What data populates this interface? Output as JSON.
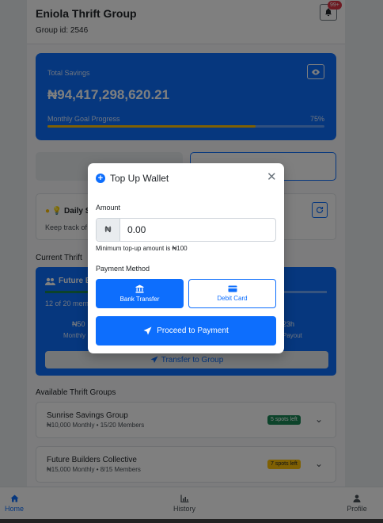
{
  "header": {
    "title": "Eniola Thrift Group",
    "group_id": "Group id: 2546",
    "notification_badge": "99+"
  },
  "savings": {
    "label": "Total Savings",
    "amount": "₦94,417,298,620.21",
    "goal_label": "Monthly Goal Progress",
    "goal_percent_text": "75%",
    "goal_progress": 0.75
  },
  "tip": {
    "title": "💡 Daily S",
    "text": "Keep track of"
  },
  "current_section": {
    "title": "Current Thrift",
    "name": "Future B",
    "members": "12 of 20 members",
    "amount": "₦50",
    "monthly_label": "Monthly",
    "time": "23h",
    "payout_label": "Payout",
    "transfer_label": "Transfer to Group",
    "progress": 0.6
  },
  "available_section": {
    "title": "Available Thrift Groups",
    "groups": [
      {
        "name": "Sunrise Savings Group",
        "details": "₦10,000 Monthly • 15/20 Members",
        "badge": "5 spots left",
        "badge_color": "#198754"
      },
      {
        "name": "Future Builders Collective",
        "details": "₦15,000 Monthly • 8/15 Members",
        "badge": "7 spots left",
        "badge_color": "#ffc107"
      }
    ]
  },
  "bottom_nav": {
    "home": "Home",
    "history": "History",
    "profile": "Profile"
  },
  "modal": {
    "title": "Top Up Wallet",
    "amount_label": "Amount",
    "currency_prefix": "₦",
    "amount_placeholder": "0.00",
    "hint": "Minimum top-up amount is ₦100",
    "payment_method_label": "Payment Method",
    "bank_transfer_label": "Bank Transfer",
    "debit_card_label": "Debit Card",
    "proceed_label": "Proceed to Payment"
  },
  "colors": {
    "primary": "#0d6efd",
    "success": "#198754",
    "warning": "#ffc107",
    "danger": "#dc3545"
  }
}
